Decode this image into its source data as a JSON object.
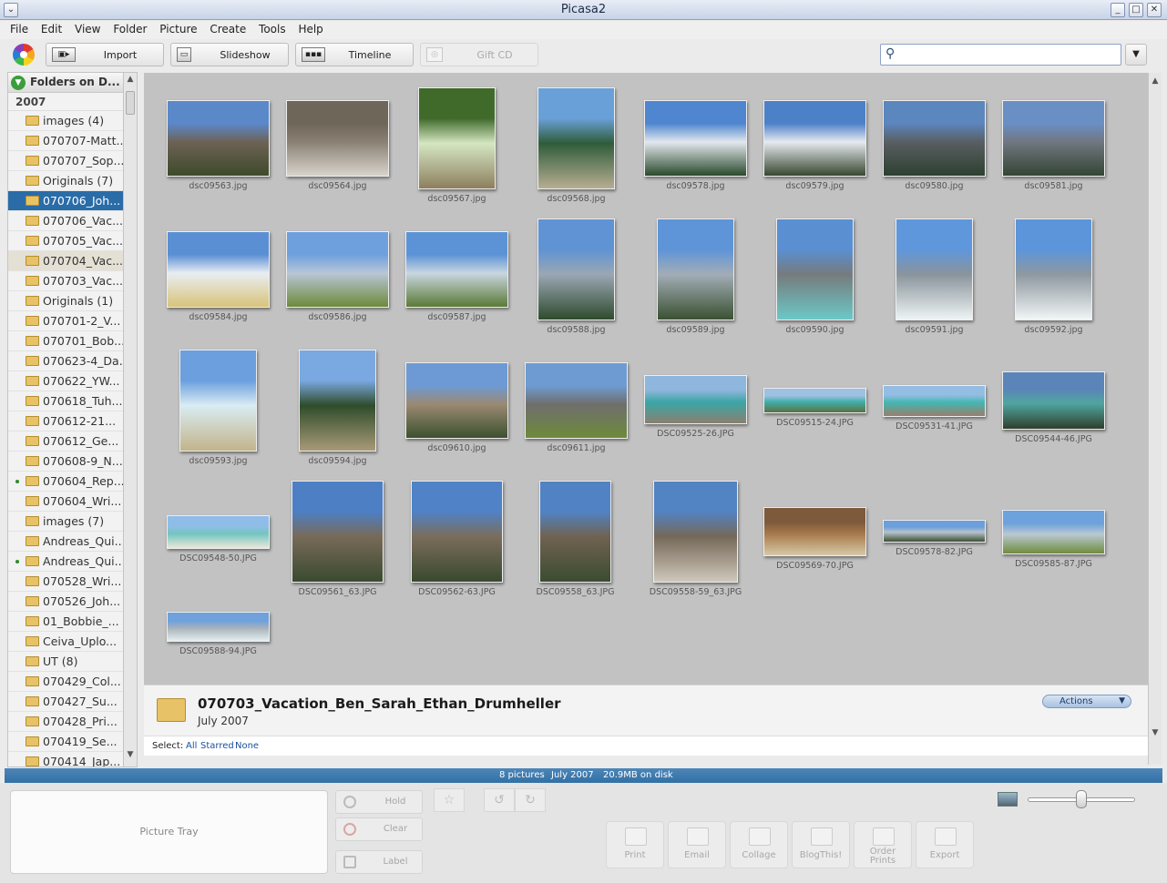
{
  "window": {
    "title": "Picasa2"
  },
  "menu": [
    "File",
    "Edit",
    "View",
    "Folder",
    "Picture",
    "Create",
    "Tools",
    "Help"
  ],
  "toolbar": {
    "import": "Import",
    "slideshow": "Slideshow",
    "timeline": "Timeline",
    "giftcd": "Gift CD",
    "search_value": ""
  },
  "sidebar": {
    "header": "Folders on D...",
    "year": "2007",
    "folders": [
      {
        "name": "images (4)",
        "state": ""
      },
      {
        "name": "070707-Matt...",
        "state": ""
      },
      {
        "name": "070707_Sop...",
        "state": ""
      },
      {
        "name": "Originals (7)",
        "state": ""
      },
      {
        "name": "070706_Joh...",
        "state": "selected"
      },
      {
        "name": "070706_Vac...",
        "state": ""
      },
      {
        "name": "070705_Vac...",
        "state": ""
      },
      {
        "name": "070704_Vac...",
        "state": "highlight"
      },
      {
        "name": "070703_Vac...",
        "state": ""
      },
      {
        "name": "Originals (1)",
        "state": ""
      },
      {
        "name": "070701-2_V...",
        "state": ""
      },
      {
        "name": "070701_Bob...",
        "state": ""
      },
      {
        "name": "070623-4_Da...",
        "state": ""
      },
      {
        "name": "070622_YW...",
        "state": ""
      },
      {
        "name": "070618_Tuh...",
        "state": ""
      },
      {
        "name": "070612-21...",
        "state": ""
      },
      {
        "name": "070612_Ge...",
        "state": ""
      },
      {
        "name": "070608-9_N...",
        "state": ""
      },
      {
        "name": "070604_Rep...",
        "state": "dot"
      },
      {
        "name": "070604_Wri...",
        "state": ""
      },
      {
        "name": "images (7)",
        "state": ""
      },
      {
        "name": "Andreas_Qui...",
        "state": ""
      },
      {
        "name": "Andreas_Qui...",
        "state": "dot"
      },
      {
        "name": "070528_Wri...",
        "state": ""
      },
      {
        "name": "070526_Joh...",
        "state": ""
      },
      {
        "name": "01_Bobbie_...",
        "state": ""
      },
      {
        "name": "Ceiva_Uplo...",
        "state": ""
      },
      {
        "name": "UT (8)",
        "state": ""
      },
      {
        "name": "070429_Col...",
        "state": ""
      },
      {
        "name": "070427_Su...",
        "state": ""
      },
      {
        "name": "070428_Pri...",
        "state": ""
      },
      {
        "name": "070419_Se...",
        "state": ""
      },
      {
        "name": "070414_Jap...",
        "state": ""
      }
    ]
  },
  "thumbnails": [
    {
      "file": "dsc09563.jpg",
      "colors": [
        "#5b88c9",
        "#6d6255",
        "#3e4a2a"
      ]
    },
    {
      "file": "dsc09564.jpg",
      "colors": [
        "#6e6659",
        "#8a8174",
        "#d8d4cc"
      ]
    },
    {
      "file": "dsc09567.jpg",
      "colors": [
        "#3f6a2a",
        "#d5e6c2",
        "#8d7f5e"
      ]
    },
    {
      "file": "dsc09568.jpg",
      "colors": [
        "#6aa0d8",
        "#2f5c3a",
        "#b7ad92"
      ]
    },
    {
      "file": "dsc09578.jpg",
      "colors": [
        "#4f86cf",
        "#e3e8ee",
        "#2a4a2c"
      ]
    },
    {
      "file": "dsc09579.jpg",
      "colors": [
        "#4d81c7",
        "#e6eaf0",
        "#38472f"
      ]
    },
    {
      "file": "dsc09580.jpg",
      "colors": [
        "#5c86be",
        "#595e62",
        "#2d4030"
      ]
    },
    {
      "file": "dsc09581.jpg",
      "colors": [
        "#6a8fc4",
        "#707780",
        "#344534"
      ]
    },
    {
      "file": "dsc09584.jpg",
      "colors": [
        "#5a8fd4",
        "#e9edf2",
        "#d8c47a"
      ]
    },
    {
      "file": "dsc09586.jpg",
      "colors": [
        "#6ea0de",
        "#b8c6d6",
        "#6e8a3a"
      ]
    },
    {
      "file": "dsc09587.jpg",
      "colors": [
        "#5c93d6",
        "#c9d6e0",
        "#5a7a36"
      ]
    },
    {
      "file": "dsc09588.jpg",
      "colors": [
        "#5f93d3",
        "#9aa7b4",
        "#2f4b2d"
      ]
    },
    {
      "file": "dsc09589.jpg",
      "colors": [
        "#5e94d8",
        "#a2adb6",
        "#3b5132"
      ]
    },
    {
      "file": "dsc09590.jpg",
      "colors": [
        "#5a8fd2",
        "#767b7d",
        "#6cc8c6"
      ]
    },
    {
      "file": "dsc09591.jpg",
      "colors": [
        "#5f97dc",
        "#8a949c",
        "#eef4f4"
      ]
    },
    {
      "file": "dsc09592.jpg",
      "colors": [
        "#5c95da",
        "#8e98a0",
        "#f1f6f6"
      ]
    },
    {
      "file": "dsc09593.jpg",
      "colors": [
        "#6b9fde",
        "#d9ecf2",
        "#c2b48a"
      ]
    },
    {
      "file": "dsc09594.jpg",
      "colors": [
        "#7aa8e0",
        "#2f4c2a",
        "#a89a78"
      ]
    },
    {
      "file": "dsc09610.jpg",
      "colors": [
        "#6d9ad4",
        "#9b8a72",
        "#3c5030"
      ]
    },
    {
      "file": "dsc09611.jpg",
      "colors": [
        "#6e9bd2",
        "#6f6e6c",
        "#6e8a3a"
      ]
    },
    {
      "file": "DSC09525-26.JPG",
      "colors": [
        "#8fb6dd",
        "#3aa6a6",
        "#8a8070"
      ]
    },
    {
      "file": "DSC09515-24.JPG",
      "colors": [
        "#9ec0e2",
        "#3fb0aa",
        "#5e7044"
      ]
    },
    {
      "file": "DSC09531-41.JPG",
      "colors": [
        "#94bde4",
        "#43b6b0",
        "#9b7d6d"
      ]
    },
    {
      "file": "DSC09544-46.JPG",
      "colors": [
        "#5b84b8",
        "#4fa6a0",
        "#2f3f2c"
      ]
    },
    {
      "file": "DSC09548-50.JPG",
      "colors": [
        "#90bde8",
        "#73c6c0",
        "#eae6da"
      ]
    },
    {
      "file": "DSC09561_63.JPG",
      "colors": [
        "#4d7fc4",
        "#786a58",
        "#3a4a30"
      ]
    },
    {
      "file": "DSC09562-63.JPG",
      "colors": [
        "#4f82c6",
        "#7a6d5c",
        "#39492e"
      ]
    },
    {
      "file": "DSC09558_63.JPG",
      "colors": [
        "#5183c4",
        "#706252",
        "#3b4c31"
      ]
    },
    {
      "file": "DSC09558-59_63.JPG",
      "colors": [
        "#5283c3",
        "#756858",
        "#cfc8bb"
      ]
    },
    {
      "file": "DSC09569-70.JPG",
      "colors": [
        "#7d5a3c",
        "#a87a4c",
        "#d7c9a7"
      ]
    },
    {
      "file": "DSC09578-82.JPG",
      "colors": [
        "#6d9fdb",
        "#b7c2cc",
        "#3c5034"
      ]
    },
    {
      "file": "DSC09585-87.JPG",
      "colors": [
        "#6ea2dc",
        "#bac8d2",
        "#6f8c3c"
      ]
    },
    {
      "file": "DSC09588-94.JPG",
      "colors": [
        "#6fa1dc",
        "#a7b2ba",
        "#e4eef0"
      ]
    }
  ],
  "folder_info": {
    "title": "070703_Vacation_Ben_Sarah_Ethan_Drumheller",
    "date": "July 2007",
    "actions": "Actions"
  },
  "select": {
    "label": "Select:",
    "all": "All",
    "starred": "Starred",
    "none": "None"
  },
  "status": {
    "count": "8 pictures",
    "date": "July 2007",
    "size": "20.9MB on disk"
  },
  "tray": {
    "label": "Picture Tray",
    "hold": "Hold",
    "clear": "Clear",
    "label_btn": "Label"
  },
  "actions_bar": [
    {
      "label": "Print",
      "name": "print"
    },
    {
      "label": "Email",
      "name": "email"
    },
    {
      "label": "Collage",
      "name": "collage"
    },
    {
      "label": "BlogThis!",
      "name": "blogthis"
    },
    {
      "label": "Order\nPrints",
      "name": "order-prints"
    },
    {
      "label": "Export",
      "name": "export"
    }
  ],
  "zoom": {
    "level": 0.5
  }
}
